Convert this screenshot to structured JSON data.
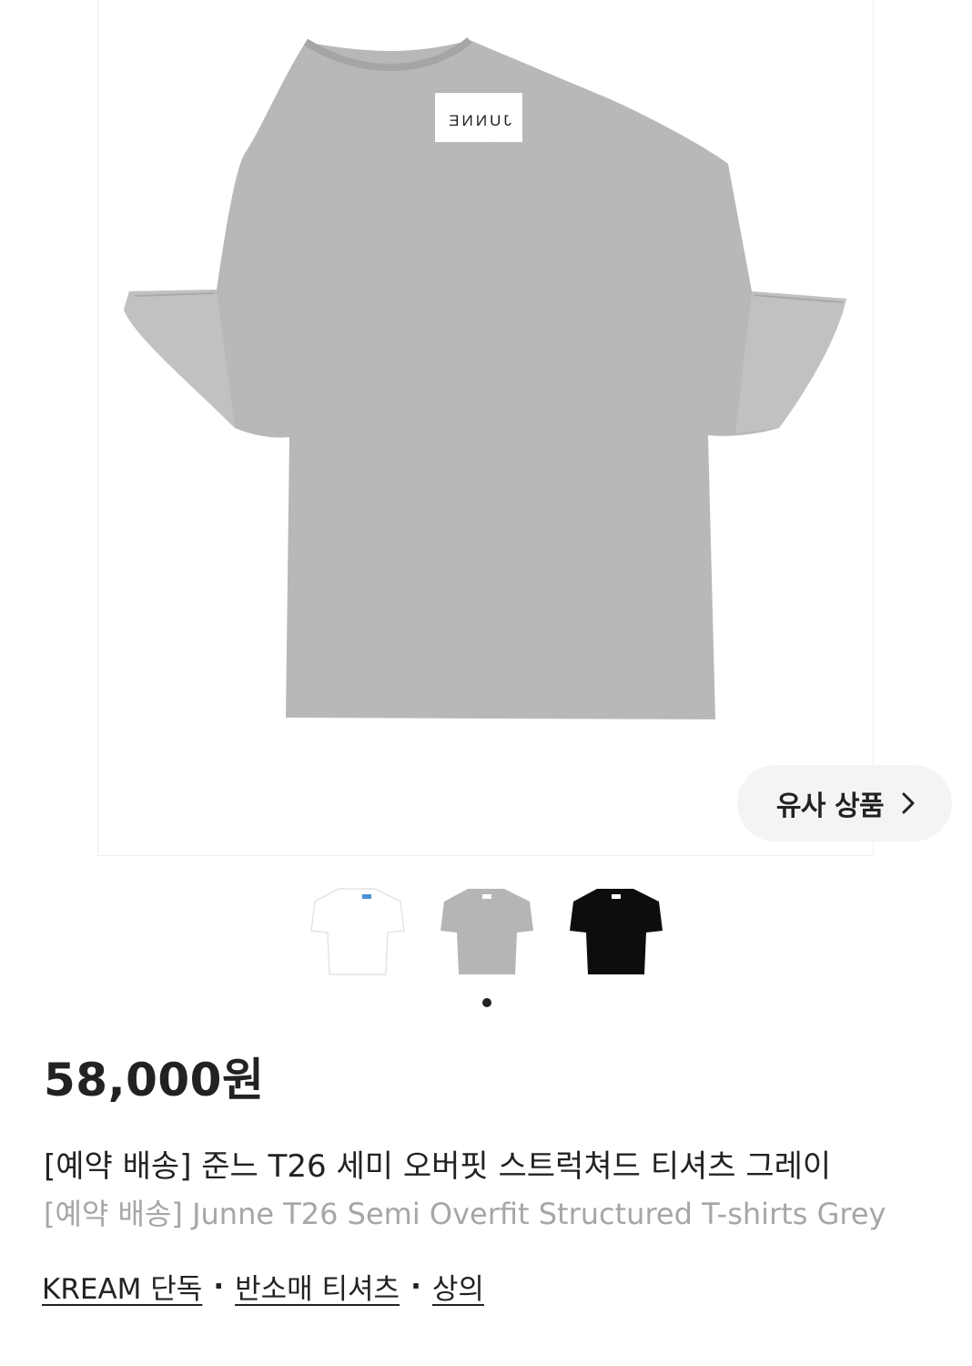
{
  "product_image": {
    "label_text": "JUNNE",
    "shirt_color": "#b7b7b7",
    "label_color": "#ffffff"
  },
  "similar_button": {
    "label": "유사 상품",
    "icon": "chevron-right-icon"
  },
  "thumbnails": [
    {
      "color_name": "white",
      "color": "#ffffff"
    },
    {
      "color_name": "gray",
      "color": "#b5b5b5"
    },
    {
      "color_name": "black",
      "color": "#0d0d0d"
    }
  ],
  "pagination": {
    "active_index": 0,
    "count": 1
  },
  "price": "58,000원",
  "title_ko": "[예약 배송] 준느 T26 세미 오버핏 스트럭쳐드 티셔츠 그레이",
  "title_en": "[예약 배송] Junne T26 Semi Overfit Structured T-shirts Grey",
  "tags": [
    {
      "label": "KREAM 단독"
    },
    {
      "label": "반소매 티셔츠"
    },
    {
      "label": "상의"
    }
  ],
  "tag_separator": "·"
}
